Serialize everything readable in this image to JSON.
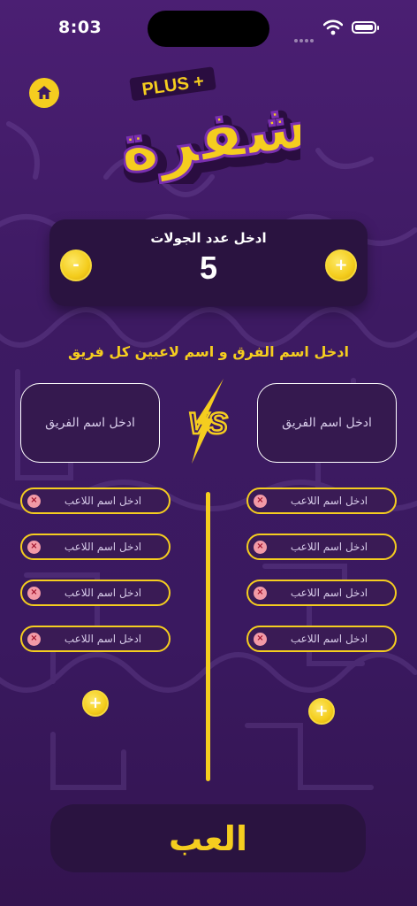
{
  "status_bar": {
    "time": "8:03"
  },
  "logo": {
    "plus_text": "PLUS +",
    "title": "شفرة"
  },
  "rounds": {
    "label": "ادخل عدد الجولات",
    "value": "5",
    "minus_symbol": "-",
    "plus_symbol": "+"
  },
  "instruction": "ادخل اسم الفرق و اسم لاعبين كل فريق",
  "teams": {
    "left": {
      "placeholder": "ادخل اسم الفريق"
    },
    "right": {
      "placeholder": "ادخل اسم الفريق"
    },
    "vs_text": "VS"
  },
  "players": {
    "left": [
      "ادخل اسم اللاعب",
      "ادخل اسم اللاعب",
      "ادخل اسم اللاعب",
      "ادخل اسم اللاعب"
    ],
    "right": [
      "ادخل اسم اللاعب",
      "ادخل اسم اللاعب",
      "ادخل اسم اللاعب",
      "ادخل اسم اللاعب"
    ],
    "remove_symbol": "×",
    "add_symbol": "+"
  },
  "play_button": "العب",
  "colors": {
    "accent": "#f5cd1f",
    "background": "#3d1a62",
    "card": "#2a1340"
  },
  "icons": {
    "home": "home-icon",
    "wifi": "wifi-icon",
    "battery": "battery-icon"
  }
}
